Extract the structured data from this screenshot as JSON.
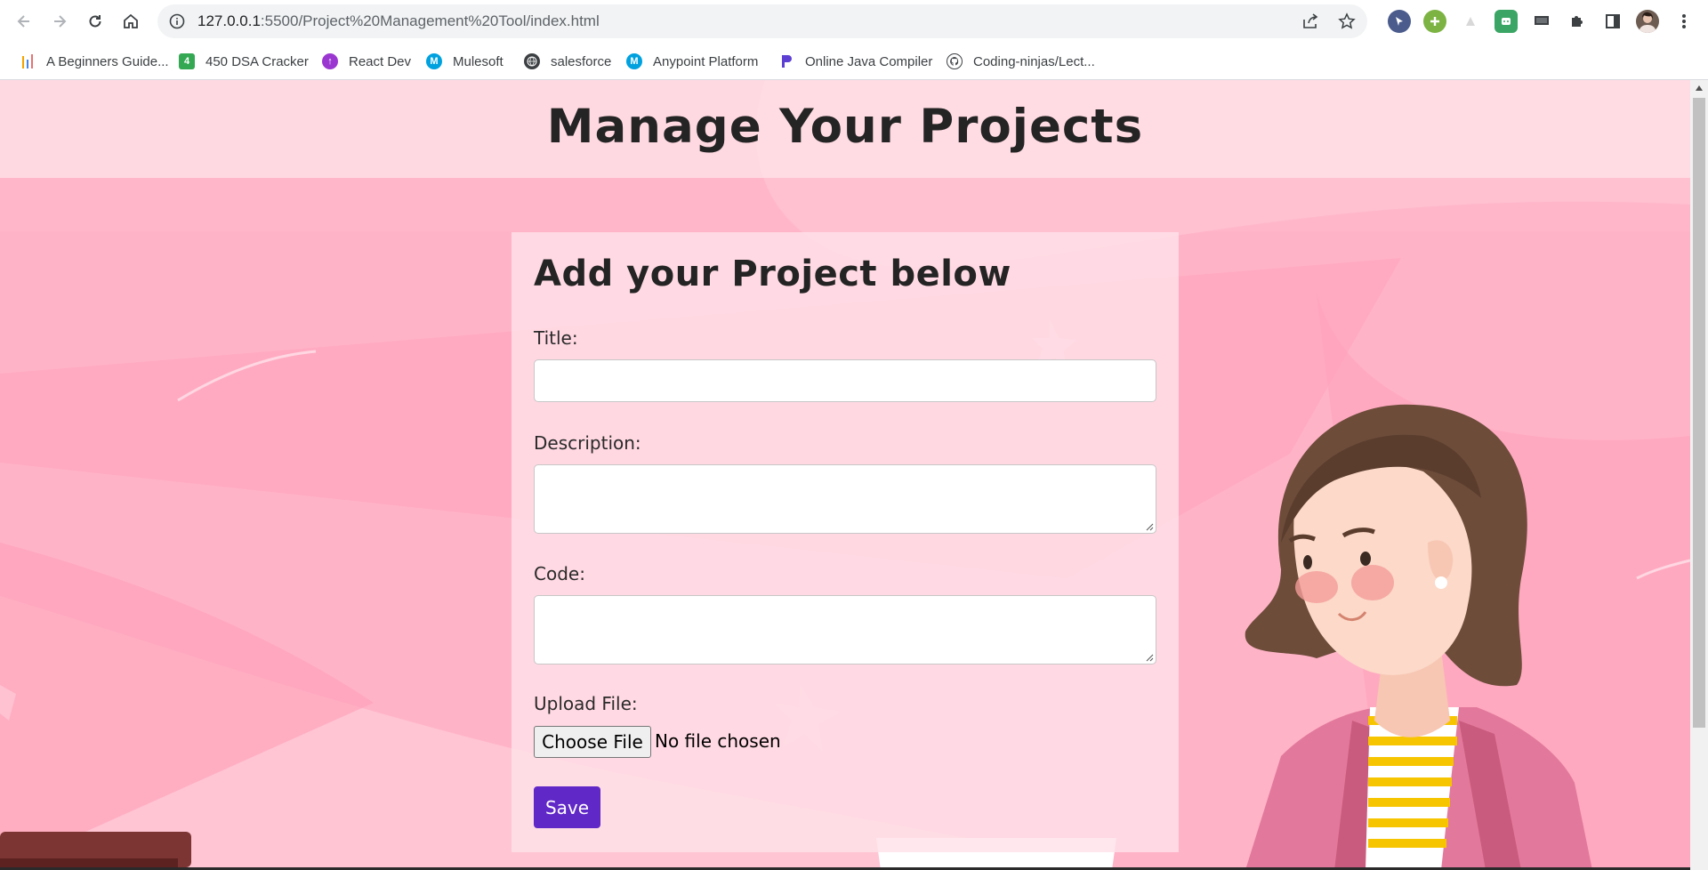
{
  "browser": {
    "url_host": "127.0.0.1",
    "url_rest": ":5500/Project%20Management%20Tool/index.html",
    "bookmarks": [
      {
        "label": "A Beginners Guide...",
        "icon": "bar-chart-icon",
        "color": "#f4a300"
      },
      {
        "label": "450 DSA Cracker",
        "icon": "number-4-icon",
        "color": "#34a853"
      },
      {
        "label": "React Dev",
        "icon": "react-dev-icon",
        "color": "#9b37d1"
      },
      {
        "label": "Mulesoft",
        "icon": "mulesoft-icon",
        "color": "#00a1df"
      },
      {
        "label": "salesforce",
        "icon": "globe-icon",
        "color": "#3c4043"
      },
      {
        "label": "Anypoint Platform",
        "icon": "mulesoft-icon",
        "color": "#00a1df"
      },
      {
        "label": "Online Java Compiler",
        "icon": "programiz-icon",
        "color": "#5d3fd3"
      },
      {
        "label": "Coding-ninjas/Lect...",
        "icon": "github-icon",
        "color": "#3c4043"
      }
    ]
  },
  "page": {
    "title": "Manage Your Projects",
    "form": {
      "heading": "Add your Project below",
      "title_label": "Title:",
      "title_value": "",
      "description_label": "Description:",
      "description_value": "",
      "code_label": "Code:",
      "code_value": "",
      "upload_label": "Upload File:",
      "choose_file_label": "Choose File",
      "no_file_text": "No file chosen",
      "save_label": "Save"
    }
  },
  "colors": {
    "accent": "#6128c8",
    "background_pink": "#ffb6c9"
  }
}
